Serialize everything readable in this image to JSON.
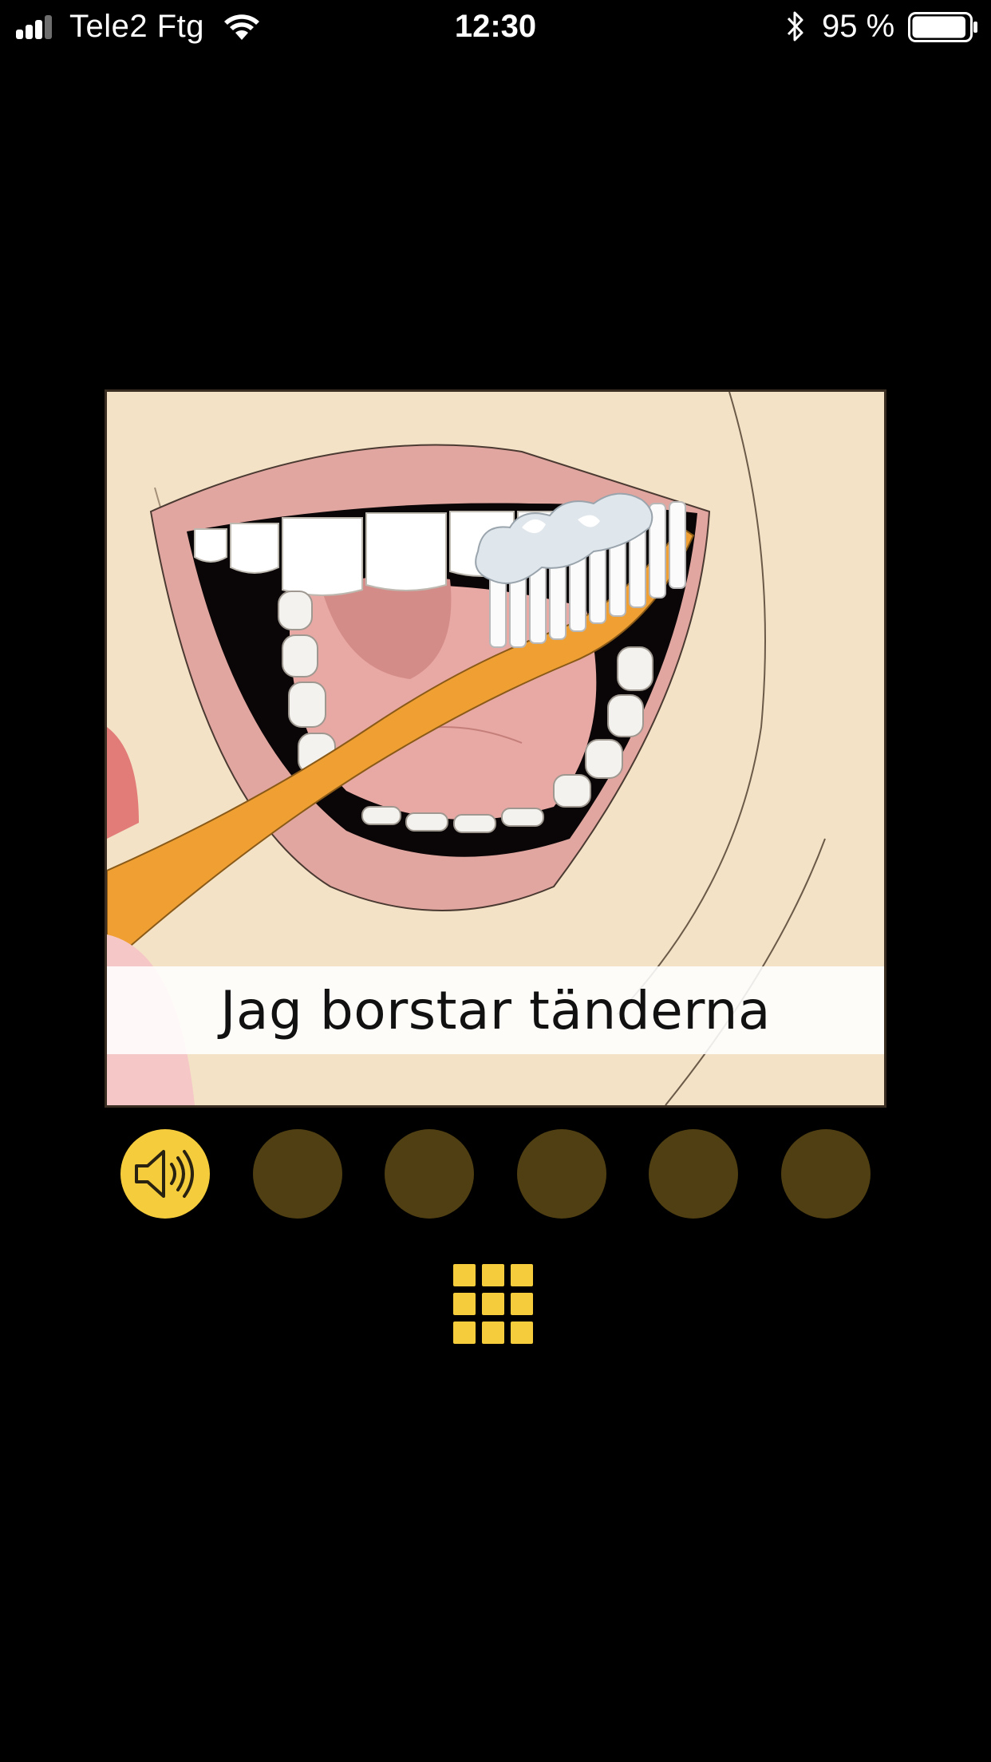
{
  "status_bar": {
    "carrier": "Tele2 Ftg",
    "time": "12:30",
    "battery_percent": "95 %",
    "battery_level": 0.95,
    "icons": [
      "signal-icon",
      "wifi-icon",
      "bluetooth-icon",
      "battery-icon"
    ]
  },
  "card": {
    "caption": "Jag borstar tänderna",
    "illustration": "toothbrushing-illustration"
  },
  "dots": {
    "items": [
      {
        "name": "sound",
        "icon": "speaker-icon",
        "active": true
      },
      {
        "name": "dot-2",
        "active": false
      },
      {
        "name": "dot-3",
        "active": false
      },
      {
        "name": "dot-4",
        "active": false
      },
      {
        "name": "dot-5",
        "active": false
      },
      {
        "name": "dot-6",
        "active": false
      }
    ]
  },
  "grid_button": {
    "icon": "grid-icon"
  },
  "colors": {
    "background": "#000000",
    "accent": "#f5cc3c",
    "dot_inactive": "#4f3f12",
    "skin": "#f3e2c6",
    "toothbrush": "#f0a032"
  }
}
